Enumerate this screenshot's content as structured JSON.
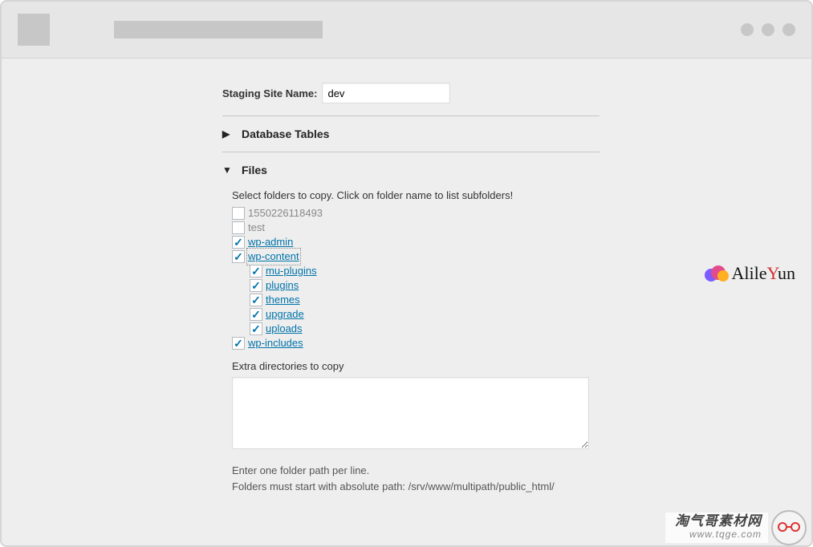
{
  "staging": {
    "label": "Staging Site Name:",
    "value": "dev"
  },
  "sections": {
    "db": {
      "title": "Database Tables",
      "expanded": false
    },
    "files": {
      "title": "Files",
      "expanded": true,
      "help": "Select folders to copy. Click on folder name to list subfolders!",
      "tree": [
        {
          "name": "1550226118493",
          "checked": false,
          "link": false
        },
        {
          "name": "test",
          "checked": false,
          "link": false
        },
        {
          "name": "wp-admin",
          "checked": true,
          "link": true
        },
        {
          "name": "wp-content",
          "checked": true,
          "link": true,
          "focused": true,
          "children": [
            {
              "name": "mu-plugins",
              "checked": true,
              "link": true
            },
            {
              "name": "plugins",
              "checked": true,
              "link": true
            },
            {
              "name": "themes",
              "checked": true,
              "link": true
            },
            {
              "name": "upgrade",
              "checked": true,
              "link": true
            },
            {
              "name": "uploads",
              "checked": true,
              "link": true
            }
          ]
        },
        {
          "name": "wp-includes",
          "checked": true,
          "link": true
        }
      ],
      "extra_label": "Extra directories to copy",
      "extra_value": "",
      "hint1": "Enter one folder path per line.",
      "hint2": "Folders must start with absolute path: /srv/www/multipath/public_html/"
    }
  },
  "watermarks": {
    "alileyun_pre": "Alile",
    "alileyun_red": "Y",
    "alileyun_post": "un",
    "tqge_l1": "淘气哥素材网",
    "tqge_l2": "www.tqge.com"
  }
}
